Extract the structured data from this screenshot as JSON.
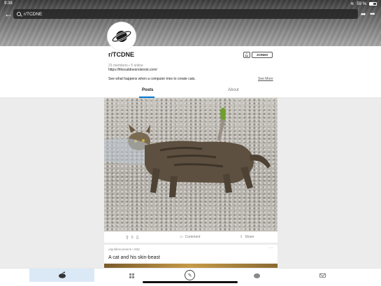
{
  "status": {
    "time": "9:38",
    "battery": "59 %"
  },
  "search": {
    "value": "r/TCDNE"
  },
  "subreddit": {
    "name": "r/TCDNE",
    "stats": "23 members • 5 online",
    "website": "https://thiscatdoesnotexist.com/",
    "description": "See what happens when a computer tries to create cats.",
    "see_more": "See More",
    "joined_label": "JOINED"
  },
  "tabs": {
    "posts": "Posts",
    "about": "About"
  },
  "post": {
    "score": "5",
    "comment_label": "Comment",
    "share_label": "Share"
  },
  "next_post": {
    "meta": "u/goldenvonarck • 83d",
    "title": "A cat and his skin-beast"
  },
  "colors": {
    "accent": "#0079d3",
    "active_nav_bg": "#dbe9f7"
  },
  "icons": [
    "back-arrow-icon",
    "search-icon",
    "share-icon",
    "more-icon",
    "planet-icon",
    "bell-icon",
    "upvote-icon",
    "downvote-icon",
    "comment-icon",
    "share-post-icon",
    "home-icon",
    "grid-icon",
    "pencil-icon",
    "chat-icon",
    "mail-icon"
  ]
}
